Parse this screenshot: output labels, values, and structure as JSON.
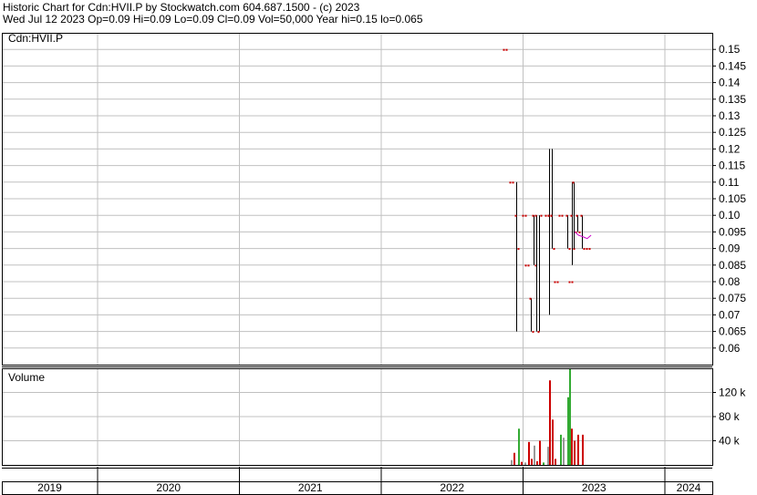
{
  "header": {
    "line1": "Historic Chart for Cdn:HVII.P by Stockwatch.com 604.687.1500 - (c) 2023",
    "line2": "Wed Jul 12 2023  Op=0.09  Hi=0.09  Lo=0.09  Cl=0.09  Vol=50,000  Year hi=0.15  lo=0.065"
  },
  "colors": {
    "grid": "#c0c0c0",
    "price_bar": "#000000",
    "price_dot": "#cc0000",
    "vol_up": "#33aa33",
    "vol_down": "#cc0000",
    "vol_flat": "#999999",
    "recent": "#cc00cc"
  },
  "chart_data": [
    {
      "type": "price-bar",
      "title": "Cdn:HVII.P",
      "ylim": [
        0.055,
        0.155
      ],
      "y_ticks": [
        "0.15",
        "0.145",
        "0.14",
        "0.135",
        "0.13",
        "0.125",
        "0.12",
        "0.115",
        "0.11",
        "0.105",
        "0.10",
        "0.095",
        "0.09",
        "0.085",
        "0.08",
        "0.075",
        "0.07",
        "0.065",
        "0.06"
      ],
      "x_ticks": [
        "2019",
        "2020",
        "2021",
        "2022",
        "2023",
        "2024"
      ],
      "bars": [
        {
          "date": "2022-11-15",
          "low": 0.15,
          "high": 0.15,
          "open": 0.15,
          "close": 0.15
        },
        {
          "date": "2022-12-01",
          "low": 0.11,
          "high": 0.11,
          "open": 0.11,
          "close": 0.11
        },
        {
          "date": "2022-12-15",
          "low": 0.065,
          "high": 0.11,
          "open": 0.1,
          "close": 0.09
        },
        {
          "date": "2023-01-01",
          "low": 0.1,
          "high": 0.1,
          "open": 0.1,
          "close": 0.1
        },
        {
          "date": "2023-01-10",
          "low": 0.085,
          "high": 0.085,
          "open": 0.085,
          "close": 0.085
        },
        {
          "date": "2023-01-20",
          "low": 0.065,
          "high": 0.075,
          "open": 0.075,
          "close": 0.065
        },
        {
          "date": "2023-01-27",
          "low": 0.085,
          "high": 0.1,
          "open": 0.1,
          "close": 0.085
        },
        {
          "date": "2023-02-04",
          "low": 0.065,
          "high": 0.1,
          "open": 0.1,
          "close": 0.065
        },
        {
          "date": "2023-02-12",
          "low": 0.065,
          "high": 0.1,
          "open": 0.065,
          "close": 0.1
        },
        {
          "date": "2023-03-01",
          "low": 0.1,
          "high": 0.1,
          "open": 0.1,
          "close": 0.1
        },
        {
          "date": "2023-03-10",
          "low": 0.07,
          "high": 0.12,
          "open": 0.1,
          "close": 0.1
        },
        {
          "date": "2023-03-17",
          "low": 0.09,
          "high": 0.12,
          "open": 0.1,
          "close": 0.09
        },
        {
          "date": "2023-03-25",
          "low": 0.08,
          "high": 0.08,
          "open": 0.08,
          "close": 0.08
        },
        {
          "date": "2023-04-05",
          "low": 0.1,
          "high": 0.1,
          "open": 0.1,
          "close": 0.1
        },
        {
          "date": "2023-04-25",
          "low": 0.09,
          "high": 0.1,
          "open": 0.1,
          "close": 0.09
        },
        {
          "date": "2023-05-01",
          "low": 0.08,
          "high": 0.08,
          "open": 0.08,
          "close": 0.08
        },
        {
          "date": "2023-05-06",
          "low": 0.085,
          "high": 0.11,
          "open": 0.1,
          "close": 0.09
        },
        {
          "date": "2023-05-12",
          "low": 0.09,
          "high": 0.11,
          "open": 0.11,
          "close": 0.095
        },
        {
          "date": "2023-05-20",
          "low": 0.095,
          "high": 0.1,
          "open": 0.1,
          "close": 0.095
        },
        {
          "date": "2023-06-01",
          "low": 0.09,
          "high": 0.1,
          "open": 0.1,
          "close": 0.09
        },
        {
          "date": "2023-06-15",
          "low": 0.09,
          "high": 0.09,
          "open": 0.09,
          "close": 0.09
        }
      ],
      "recent_trace": [
        {
          "date": "2023-05-14",
          "value": 0.095
        },
        {
          "date": "2023-05-24",
          "value": 0.094
        },
        {
          "date": "2023-06-05",
          "value": 0.0935
        },
        {
          "date": "2023-06-15",
          "value": 0.093
        },
        {
          "date": "2023-06-25",
          "value": 0.094
        }
      ]
    },
    {
      "type": "bar",
      "title": "Volume",
      "ylim": [
        0,
        160000
      ],
      "y_ticks": [
        {
          "value": 40000,
          "label": "40 k"
        },
        {
          "value": 80000,
          "label": "80 k"
        },
        {
          "value": 120000,
          "label": "120 k"
        }
      ],
      "bars": [
        {
          "date": "2022-12-01",
          "value": 8000,
          "dir": "flat"
        },
        {
          "date": "2022-12-08",
          "value": 20000,
          "dir": "down"
        },
        {
          "date": "2022-12-18",
          "value": 60000,
          "dir": "up"
        },
        {
          "date": "2022-12-25",
          "value": 5000,
          "dir": "down"
        },
        {
          "date": "2023-01-05",
          "value": 4000,
          "dir": "flat"
        },
        {
          "date": "2023-01-15",
          "value": 38000,
          "dir": "down"
        },
        {
          "date": "2023-01-22",
          "value": 10000,
          "dir": "down"
        },
        {
          "date": "2023-01-28",
          "value": 32000,
          "dir": "flat"
        },
        {
          "date": "2023-02-05",
          "value": 6000,
          "dir": "down"
        },
        {
          "date": "2023-02-12",
          "value": 40000,
          "dir": "down"
        },
        {
          "date": "2023-02-20",
          "value": 4000,
          "dir": "up"
        },
        {
          "date": "2023-03-05",
          "value": 30000,
          "dir": "flat"
        },
        {
          "date": "2023-03-10",
          "value": 140000,
          "dir": "down"
        },
        {
          "date": "2023-03-15",
          "value": 75000,
          "dir": "down"
        },
        {
          "date": "2023-03-22",
          "value": 10000,
          "dir": "down"
        },
        {
          "date": "2023-04-05",
          "value": 50000,
          "dir": "up"
        },
        {
          "date": "2023-04-12",
          "value": 45000,
          "dir": "flat"
        },
        {
          "date": "2023-04-25",
          "value": 112000,
          "dir": "up"
        },
        {
          "date": "2023-04-30",
          "value": 160000,
          "dir": "up"
        },
        {
          "date": "2023-05-05",
          "value": 60000,
          "dir": "down"
        },
        {
          "date": "2023-05-12",
          "value": 40000,
          "dir": "down"
        },
        {
          "date": "2023-05-20",
          "value": 50000,
          "dir": "down"
        },
        {
          "date": "2023-06-01",
          "value": 50000,
          "dir": "down"
        }
      ]
    }
  ]
}
